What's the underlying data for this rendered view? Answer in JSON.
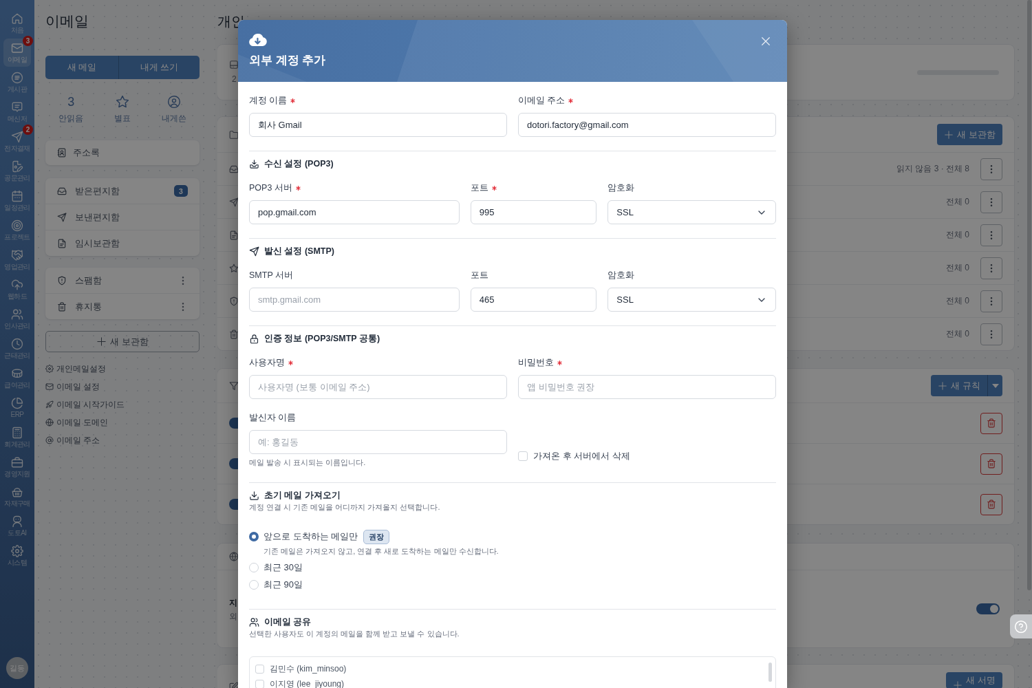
{
  "app_nav": {
    "items": [
      {
        "label": "처음",
        "selected": false
      },
      {
        "label": "이메일",
        "selected": true,
        "badge": "3"
      },
      {
        "label": "게시판",
        "selected": false
      },
      {
        "label": "메신저",
        "selected": false
      },
      {
        "label": "전자결재",
        "selected": false,
        "badge": "2"
      },
      {
        "label": "공문관리",
        "selected": false
      },
      {
        "label": "일정관리",
        "selected": false
      },
      {
        "label": "프로젝트",
        "selected": false
      },
      {
        "label": "영업관리",
        "selected": false
      },
      {
        "label": "웹하드",
        "selected": false
      },
      {
        "label": "인사관리",
        "selected": false
      },
      {
        "label": "근태관리",
        "selected": false
      },
      {
        "label": "급여관리",
        "selected": false
      },
      {
        "label": "ERP",
        "selected": false
      },
      {
        "label": "회계관리",
        "selected": false
      },
      {
        "label": "경영지원",
        "selected": false
      },
      {
        "label": "자재구매",
        "selected": false
      },
      {
        "label": "도토AI",
        "selected": false
      },
      {
        "label": "시스템",
        "selected": false
      }
    ],
    "avatar": "길동"
  },
  "mail_sidebar": {
    "title": "이메일",
    "compose_buttons": [
      "새 메일",
      "내게 쓰기"
    ],
    "stats": [
      {
        "kind": "count",
        "value": "3",
        "label": "안읽음"
      },
      {
        "kind": "icon",
        "label": "별표"
      },
      {
        "kind": "icon",
        "label": "내게쓴"
      }
    ],
    "address_book": "주소록",
    "folder_groups": [
      {
        "folders": [
          {
            "label": "받은편지함",
            "badge": "3",
            "has_menu": false
          },
          {
            "label": "보낸편지함",
            "has_menu": false
          },
          {
            "label": "임시보관함",
            "has_menu": false
          }
        ]
      },
      {
        "folders": [
          {
            "label": "스팸함",
            "has_menu": true
          },
          {
            "label": "휴지통",
            "has_menu": true
          }
        ]
      }
    ],
    "new_folder_button": "새 보관함",
    "links": [
      "개인메일설정",
      "이메일 설정",
      "이메일 시작가이드",
      "이메일 도메인",
      "이메일 주소"
    ]
  },
  "settings": {
    "title": "개인",
    "storage_card": {
      "reading": "2"
    },
    "folders_card": {
      "button": "새 보관함",
      "rows": [
        {
          "count": "읽지 않음 3 · 전체 8"
        },
        {
          "count": "전체 0"
        },
        {
          "count": "전체 0"
        },
        {
          "count": "전체 0"
        },
        {
          "count": "전체 0"
        },
        {
          "count": "전체 0"
        }
      ]
    },
    "rules_card": {
      "button": "새 규칙",
      "rules": [
        {
          "on": true
        },
        {
          "on": true
        },
        {
          "on": true
        }
      ]
    },
    "domain_card": {
      "heading": "지",
      "note": "외",
      "on": true
    },
    "signature_card": {
      "button": "새 서명"
    }
  },
  "dialog": {
    "title": "외부 계정 추가",
    "account_fields": [
      {
        "label": "계정 이름",
        "required": true,
        "kind": "text",
        "value": "회사 Gmail"
      },
      {
        "label": "이메일 주소",
        "required": true,
        "kind": "text",
        "value": "dotori.factory@gmail.com"
      }
    ],
    "incoming": {
      "title": "수신 설정 (POP3)",
      "fields": [
        {
          "label": "POP3 서버",
          "required": true,
          "kind": "text",
          "value": "pop.gmail.com"
        },
        {
          "label": "포트",
          "required": true,
          "kind": "text",
          "value": "995"
        },
        {
          "label": "암호화",
          "required": false,
          "kind": "select",
          "value": "SSL"
        }
      ]
    },
    "outgoing": {
      "title": "발신 설정 (SMTP)",
      "fields": [
        {
          "label": "SMTP 서버",
          "required": false,
          "kind": "text",
          "placeholder": "smtp.gmail.com"
        },
        {
          "label": "포트",
          "required": false,
          "kind": "text",
          "value": "465"
        },
        {
          "label": "암호화",
          "required": false,
          "kind": "select",
          "value": "SSL"
        }
      ]
    },
    "auth": {
      "title": "인증 정보 (POP3/SMTP 공통)",
      "fields": [
        {
          "label": "사용자명",
          "required": true,
          "kind": "text",
          "placeholder": "사용자명 (보통 이메일 주소)"
        },
        {
          "label": "비밀번호",
          "required": true,
          "kind": "text",
          "placeholder": "앱 비밀번호 권장"
        }
      ],
      "sender_field": {
        "label": "발신자 이름",
        "required": false,
        "kind": "text",
        "placeholder": "예: 홍길동",
        "hint": "메일 발송 시 표시되는 이름입니다."
      },
      "delete_after_fetch": {
        "label": "가져온 후 서버에서 삭제",
        "checked": false
      }
    },
    "initial_fetch": {
      "title": "초기 메일 가져오기",
      "description": "계정 연결 시 기존 메일을 어디까지 가져올지 선택합니다.",
      "options": [
        {
          "label": "앞으로 도착하는 메일만",
          "selected": true,
          "badge": "권장",
          "description": "기존 메일은 가져오지 않고, 연결 후 새로 도착하는 메일만 수신합니다."
        },
        {
          "label": "최근 30일",
          "selected": false
        },
        {
          "label": "최근 90일",
          "selected": false
        }
      ]
    },
    "sharing": {
      "title": "이메일 공유",
      "description": "선택한 사용자도 이 계정의 메일을 함께 받고 보낼 수 있습니다.",
      "users": [
        {
          "label": "김민수 (kim_minsoo)",
          "checked": false
        },
        {
          "label": "이지영 (lee_jiyoung)",
          "checked": false
        }
      ]
    }
  }
}
